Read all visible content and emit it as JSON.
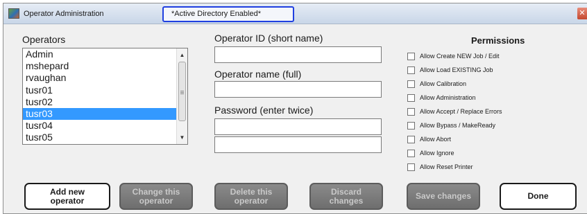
{
  "window": {
    "title": "Operator Administration",
    "ad_status": "*Active Directory Enabled*",
    "close_symbol": "✕"
  },
  "operators": {
    "label": "Operators",
    "items": [
      "Admin",
      "mshepard",
      "rvaughan",
      "tusr01",
      "tusr02",
      "tusr03",
      "tusr04",
      "tusr05"
    ],
    "selected": "tusr03"
  },
  "scrollbar": {
    "up_symbol": "▲",
    "down_symbol": "▼"
  },
  "fields": {
    "operator_id_label": "Operator ID (short name)",
    "operator_id_value": "",
    "operator_name_label": "Operator name (full)",
    "operator_name_value": "",
    "password_label": "Password (enter twice)",
    "password_value": "",
    "password_confirm_value": ""
  },
  "permissions": {
    "title": "Permissions",
    "items": [
      {
        "label": "Allow Create NEW Job / Edit",
        "checked": false
      },
      {
        "label": "Allow Load EXISTING Job",
        "checked": false
      },
      {
        "label": "Allow Calibration",
        "checked": false
      },
      {
        "label": "Allow Administration",
        "checked": false
      },
      {
        "label": "Allow Accept / Replace Errors",
        "checked": false
      },
      {
        "label": "Allow Bypass / MakeReady",
        "checked": false
      },
      {
        "label": "Allow Abort",
        "checked": false
      },
      {
        "label": "Allow Ignore",
        "checked": false
      },
      {
        "label": "Allow Reset Printer",
        "checked": false
      }
    ]
  },
  "buttons": {
    "add": "Add new\noperator",
    "change": "Change this\noperator",
    "delete": "Delete this\noperator",
    "discard": "Discard\nchanges",
    "save": "Save changes",
    "done": "Done"
  },
  "colors": {
    "selection": "#3399ff",
    "badge_border": "#1f3fe0",
    "disabled_button": "#7a7a7a"
  }
}
